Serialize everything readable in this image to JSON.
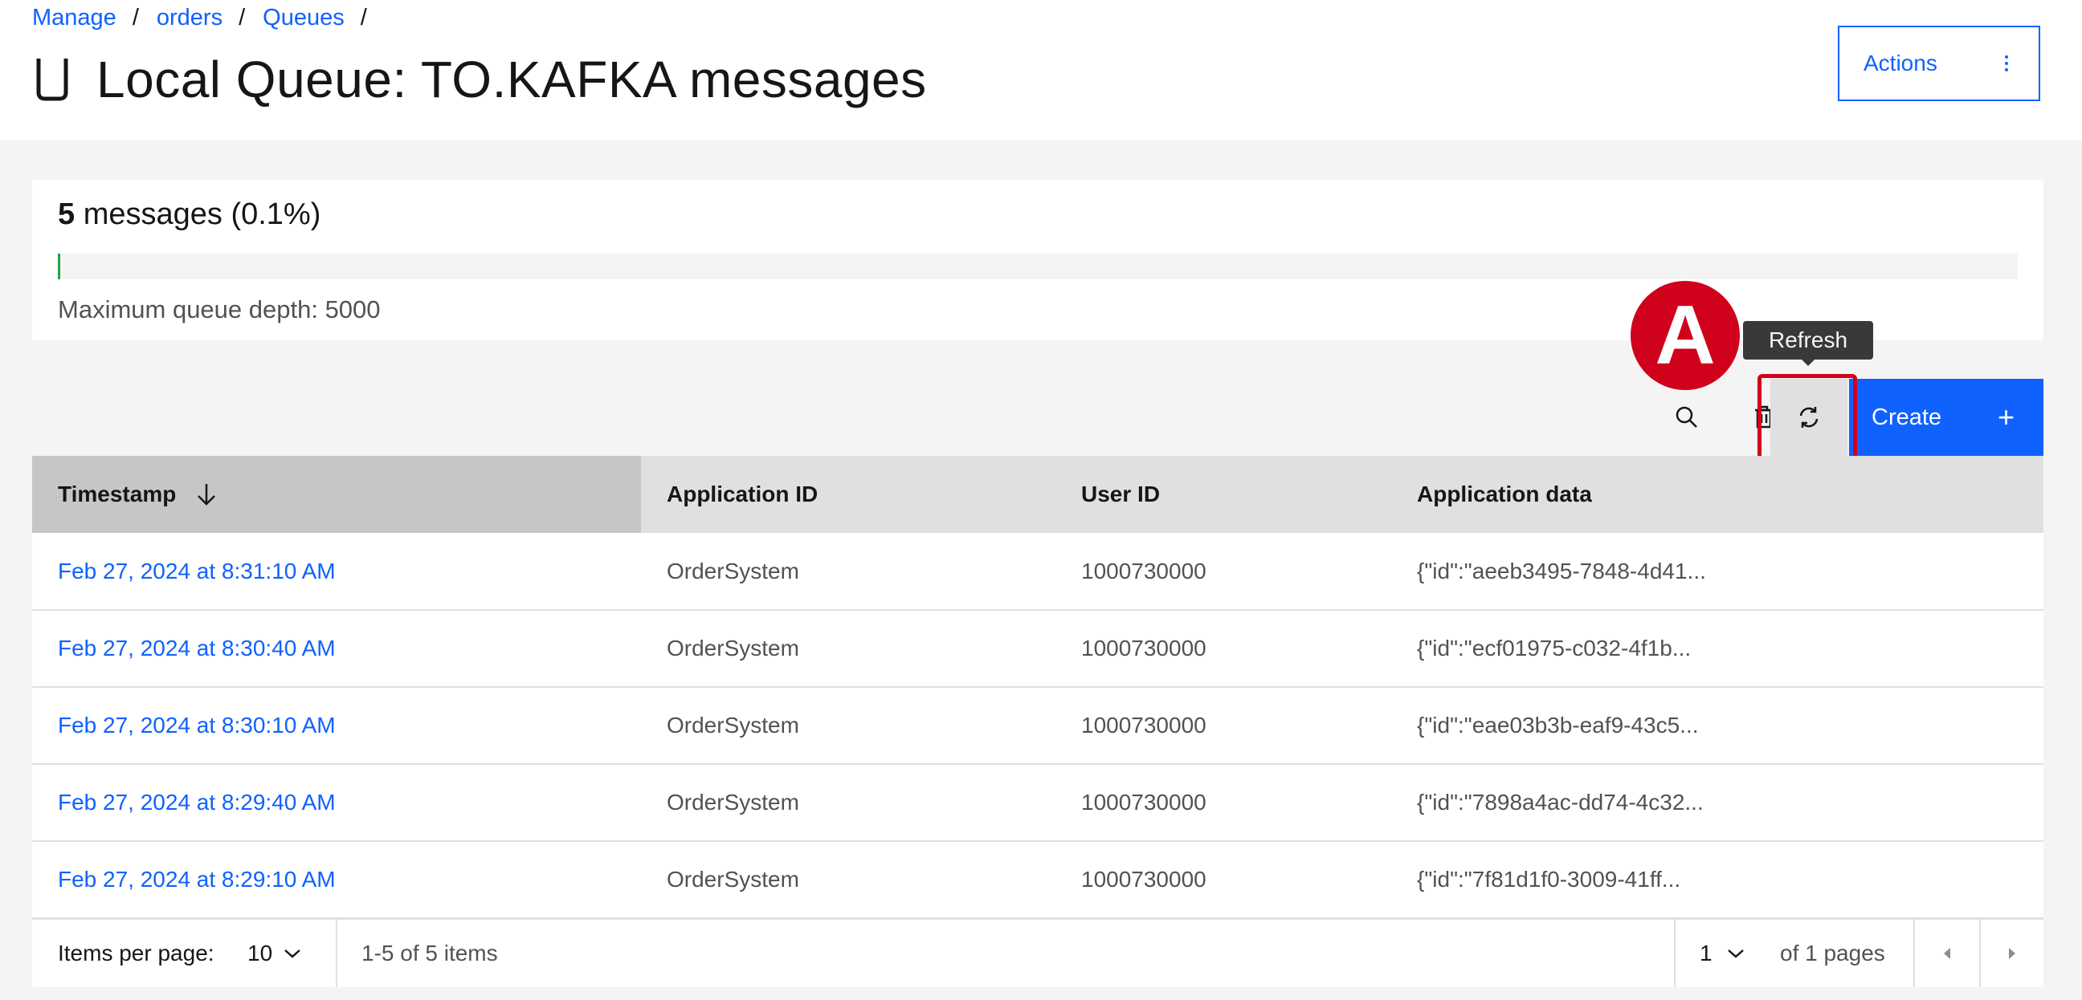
{
  "breadcrumb": [
    {
      "label": "Manage"
    },
    {
      "label": "orders"
    },
    {
      "label": "Queues"
    }
  ],
  "breadcrumb_separator": "/",
  "page": {
    "title": "Local Queue: TO.KAFKA messages"
  },
  "header": {
    "actions_label": "Actions"
  },
  "depth": {
    "count": "5",
    "label": "messages (0.1%)",
    "percent": 0.1,
    "max_label": "Maximum queue depth: 5000",
    "fill_color": "#24a148"
  },
  "toolbar": {
    "refresh_tooltip": "Refresh",
    "create_label": "Create",
    "create_plus": "+",
    "icons": [
      "search-icon",
      "trash-icon",
      "refresh-icon",
      "plus-icon"
    ]
  },
  "annotation": {
    "marker_label": "A",
    "marker_color": "#d0021b"
  },
  "table": {
    "columns": [
      "Timestamp",
      "Application ID",
      "User ID",
      "Application data"
    ],
    "sorted_column": "Timestamp",
    "sort_direction": "descending",
    "rows": [
      {
        "timestamp": "Feb 27, 2024 at 8:31:10 AM",
        "app_id": "OrderSystem",
        "user_id": "1000730000",
        "data": "{\"id\":\"aeeb3495-7848-4d41..."
      },
      {
        "timestamp": "Feb 27, 2024 at 8:30:40 AM",
        "app_id": "OrderSystem",
        "user_id": "1000730000",
        "data": "{\"id\":\"ecf01975-c032-4f1b..."
      },
      {
        "timestamp": "Feb 27, 2024 at 8:30:10 AM",
        "app_id": "OrderSystem",
        "user_id": "1000730000",
        "data": "{\"id\":\"eae03b3b-eaf9-43c5..."
      },
      {
        "timestamp": "Feb 27, 2024 at 8:29:40 AM",
        "app_id": "OrderSystem",
        "user_id": "1000730000",
        "data": "{\"id\":\"7898a4ac-dd74-4c32..."
      },
      {
        "timestamp": "Feb 27, 2024 at 8:29:10 AM",
        "app_id": "OrderSystem",
        "user_id": "1000730000",
        "data": "{\"id\":\"7f81d1f0-3009-41ff..."
      }
    ]
  },
  "pagination": {
    "items_per_page_label": "Items per page:",
    "items_per_page_value": "10",
    "range_text": "1-5 of 5 items",
    "current_page": "1",
    "of_pages_text": "of 1 pages"
  },
  "colors": {
    "primary": "#0f62fe",
    "annotation": "#d0021b",
    "tooltip_bg": "#393939"
  }
}
